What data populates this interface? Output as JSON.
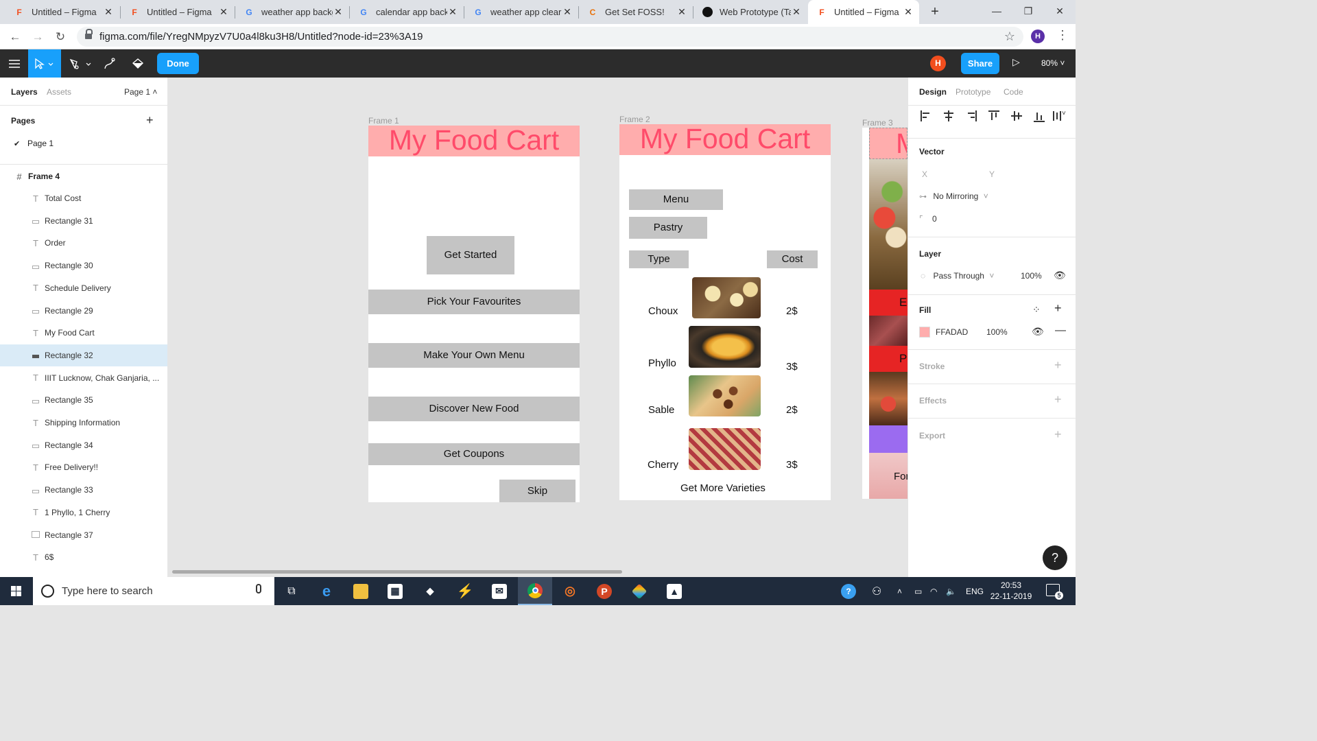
{
  "browser": {
    "tabs": [
      {
        "title": "Untitled – Figma",
        "icon": "figma-icon"
      },
      {
        "title": "Untitled – Figma",
        "icon": "figma-icon"
      },
      {
        "title": "weather app backg",
        "icon": "google-icon"
      },
      {
        "title": "calendar app back",
        "icon": "google-icon"
      },
      {
        "title": "weather app clear",
        "icon": "google-icon"
      },
      {
        "title": "Get Set FOSS!",
        "icon": "site-icon"
      },
      {
        "title": "Web Prototype (Ta",
        "icon": "github-icon"
      },
      {
        "title": "Untitled – Figma",
        "icon": "figma-icon"
      }
    ],
    "url": "figma.com/file/YregNMpyzV7U0a4l8ku3H8/Untitled?node-id=23%3A19",
    "profile_initial": "H"
  },
  "toolbar": {
    "done_label": "Done",
    "user_initial": "H",
    "share_label": "Share",
    "zoom": "80%"
  },
  "left_panel": {
    "tab_layers": "Layers",
    "tab_assets": "Assets",
    "page_selector": "Page 1 ˄",
    "pages_title": "Pages",
    "page_item": "Page 1",
    "frame_name": "Frame 4",
    "layers": [
      {
        "name": "Total Cost",
        "type": "text"
      },
      {
        "name": "Rectangle 31",
        "type": "rect"
      },
      {
        "name": "Order",
        "type": "text"
      },
      {
        "name": "Rectangle 30",
        "type": "rect"
      },
      {
        "name": "Schedule Delivery",
        "type": "text"
      },
      {
        "name": "Rectangle 29",
        "type": "rect"
      },
      {
        "name": "My Food Cart",
        "type": "text"
      },
      {
        "name": "Rectangle 32",
        "type": "rect",
        "selected": true
      },
      {
        "name": "IIIT Lucknow, Chak Ganjaria, ...",
        "type": "text"
      },
      {
        "name": "Rectangle 35",
        "type": "rect"
      },
      {
        "name": "Shipping Information",
        "type": "text"
      },
      {
        "name": "Rectangle 34",
        "type": "rect"
      },
      {
        "name": "Free Delivery!!",
        "type": "text"
      },
      {
        "name": "Rectangle 33",
        "type": "rect"
      },
      {
        "name": "1 Phyllo, 1 Cherry",
        "type": "text"
      },
      {
        "name": "Rectangle 37",
        "type": "rect"
      },
      {
        "name": "6$",
        "type": "text"
      }
    ]
  },
  "canvas": {
    "frame1": {
      "label": "Frame 1",
      "title": "My Food Cart",
      "get_started": "Get Started",
      "pick_favourites": "Pick Your Favourites",
      "make_menu": "Make Your Own Menu",
      "discover": "Discover New Food",
      "coupons": "Get Coupons",
      "skip": "Skip"
    },
    "frame2": {
      "label": "Frame 2",
      "title": "My Food Cart",
      "menu": "Menu",
      "pastry": "Pastry",
      "type_header": "Type",
      "cost_header": "Cost",
      "items": [
        {
          "name": "Choux",
          "cost": "2$"
        },
        {
          "name": "Phyllo",
          "cost": "3$"
        },
        {
          "name": "Sable",
          "cost": "2$"
        },
        {
          "name": "Cherry",
          "cost": "3$"
        }
      ],
      "more": "Get More Varieties"
    },
    "frame3": {
      "label": "Frame 3",
      "title_fragment": "M",
      "frag_e": "E",
      "frag_p": "P",
      "frag_forgo": "Forgo"
    }
  },
  "right_panel": {
    "tab_design": "Design",
    "tab_prototype": "Prototype",
    "tab_code": "Code",
    "vector_title": "Vector",
    "x_label": "X",
    "y_label": "Y",
    "mirroring": "No Mirroring",
    "corner": "0",
    "layer_title": "Layer",
    "blend": "Pass Through",
    "layer_opacity": "100%",
    "fill_title": "Fill",
    "fill_hex": "FFADAD",
    "fill_opacity": "100%",
    "fill_color": "#ffadad",
    "stroke_title": "Stroke",
    "effects_title": "Effects",
    "export_title": "Export"
  },
  "taskbar": {
    "search_placeholder": "Type here to search",
    "lang": "ENG",
    "time": "20:53",
    "date": "22-11-2019",
    "notif_count": "5"
  }
}
